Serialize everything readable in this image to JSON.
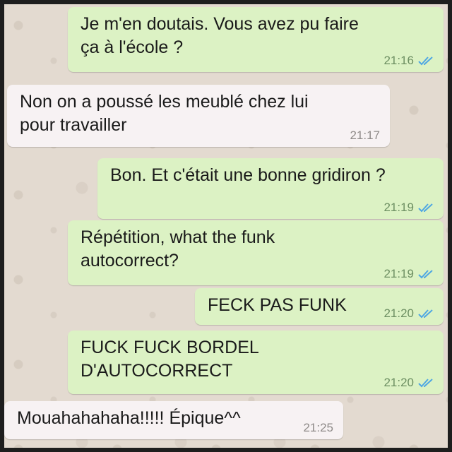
{
  "chat": {
    "tick_color": "#4fa7e3",
    "outgoing_color": "#dcf2c4",
    "incoming_color": "#f7f2f3",
    "messages": [
      {
        "direction": "out",
        "text": "Je m'en doutais. Vous avez pu faire\nça à l'école ?",
        "time": "21:16",
        "status": "double-check-read-icon"
      },
      {
        "direction": "in",
        "text": "Non on a poussé les meublé chez lui\npour travailler",
        "time": "21:17"
      },
      {
        "direction": "out",
        "text": "Bon. Et c'était une bonne gridiron ?",
        "time": "21:19",
        "status": "double-check-read-icon"
      },
      {
        "direction": "out",
        "text": "Répétition, what the funk\nautocorrect?",
        "time": "21:19",
        "status": "double-check-read-icon"
      },
      {
        "direction": "out",
        "text": "FECK PAS FUNK",
        "time": "21:20",
        "status": "double-check-read-icon"
      },
      {
        "direction": "out",
        "text": "FUCK FUCK BORDEL\nD'AUTOCORRECT",
        "time": "21:20",
        "status": "double-check-read-icon"
      },
      {
        "direction": "in",
        "text": "Mouahahahaha!!!!! Épique^^",
        "time": "21:25"
      }
    ]
  }
}
